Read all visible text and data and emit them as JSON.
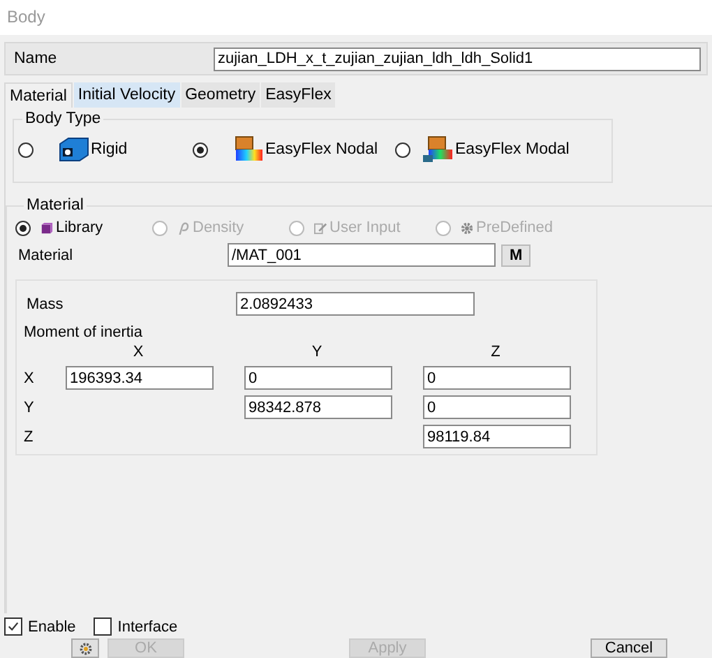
{
  "window": {
    "title": "Body"
  },
  "name": {
    "label": "Name",
    "value": "zujian_LDH_x_t_zujian_zujian_ldh_ldh_Solid1"
  },
  "tabs": [
    {
      "label": "Material",
      "selected": true
    },
    {
      "label": "Initial Velocity",
      "selected": false
    },
    {
      "label": "Geometry",
      "selected": false
    },
    {
      "label": "EasyFlex",
      "selected": false
    }
  ],
  "body_type": {
    "title": "Body Type",
    "options": [
      {
        "label": "Rigid",
        "kind": "rigid",
        "selected": false
      },
      {
        "label": "EasyFlex Nodal",
        "kind": "nodal",
        "selected": true
      },
      {
        "label": "EasyFlex Modal",
        "kind": "modal",
        "selected": false
      }
    ]
  },
  "material": {
    "title": "Material",
    "sources": [
      {
        "label": "Library",
        "kind": "library",
        "selected": true,
        "disabled": false
      },
      {
        "label": "Density",
        "kind": "density",
        "selected": false,
        "disabled": true
      },
      {
        "label": "User Input",
        "kind": "user",
        "selected": false,
        "disabled": true
      },
      {
        "label": "PreDefined",
        "kind": "predefined",
        "selected": false,
        "disabled": true
      }
    ],
    "field_label": "Material",
    "field_value": "/MAT_001",
    "button": "M",
    "mass_label": "Mass",
    "mass_value": "2.0892433",
    "inertia_label": "Moment of inertia",
    "columns": [
      "X",
      "Y",
      "Z"
    ],
    "rows": [
      {
        "label": "X",
        "values": [
          "196393.34",
          "0",
          "0"
        ]
      },
      {
        "label": "Y",
        "values": [
          "98342.878",
          "0"
        ]
      },
      {
        "label": "Z",
        "values": [
          "98119.84"
        ]
      }
    ]
  },
  "options": [
    {
      "label": "Enable",
      "checked": true
    },
    {
      "label": "Interface",
      "checked": false
    }
  ],
  "buttons": [
    {
      "label": "OK",
      "disabled": true
    },
    {
      "label": "Apply",
      "disabled": true
    },
    {
      "label": "Cancel",
      "disabled": false
    }
  ]
}
